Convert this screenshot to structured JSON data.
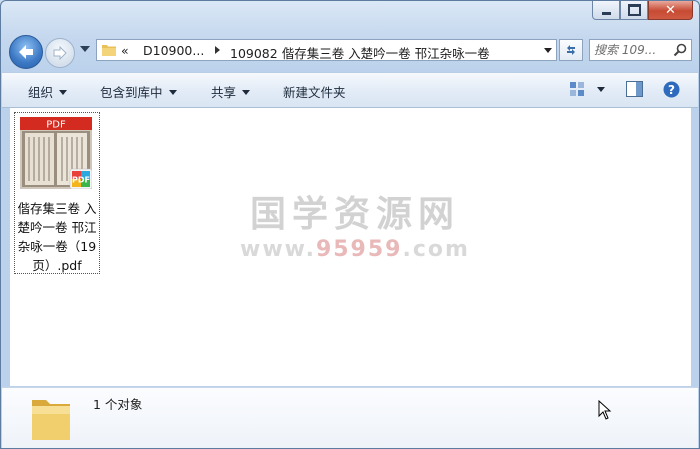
{
  "window": {
    "caption_buttons": {
      "minimize": "minimize",
      "maximize": "maximize",
      "close": "✕"
    }
  },
  "nav": {
    "address": {
      "overflow": "«",
      "segments": [
        "D10900...",
        "109082 偕存集三卷 入楚吟一卷 邗江杂咏一卷"
      ]
    },
    "search": {
      "placeholder": "搜索 109..."
    }
  },
  "toolbar": {
    "organize": "组织",
    "include_in_library": "包含到库中",
    "share": "共享",
    "new_folder": "新建文件夹"
  },
  "content": {
    "files": [
      {
        "name": "偕存集三卷 入楚吟一卷 邗江杂咏一卷（19页）.pdf",
        "badge": "PDF",
        "icon": "pdf-thumbnail-icon"
      }
    ],
    "watermark": {
      "title": "国学资源网",
      "sub_prefix": "www.",
      "sub_highlight": "95959",
      "sub_suffix": ".com"
    }
  },
  "details": {
    "count_text": "1 个对象"
  },
  "colors": {
    "accent": "#3b78c4",
    "pdf_red": "#d42b21",
    "close_red": "#c74a33"
  }
}
